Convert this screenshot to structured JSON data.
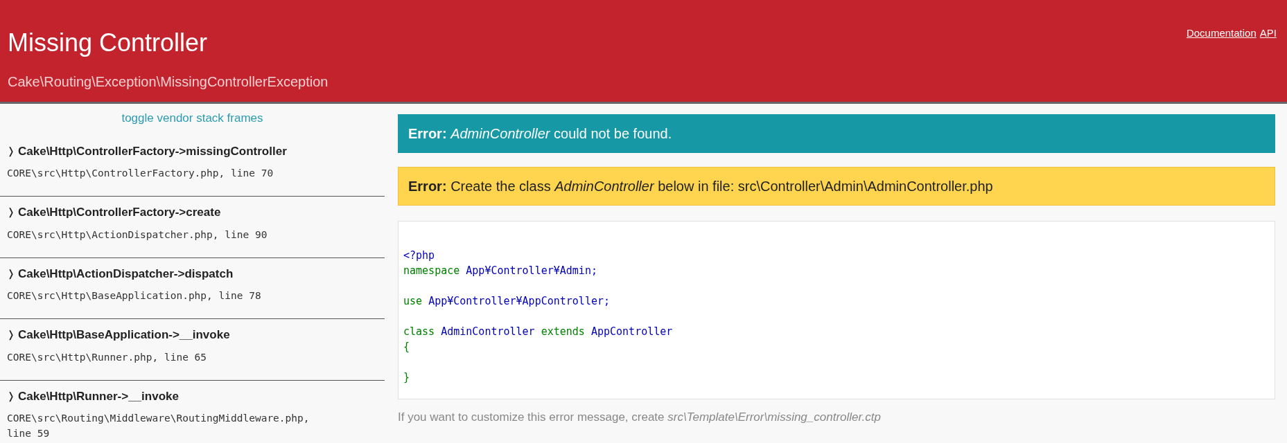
{
  "header": {
    "title": "Missing Controller",
    "subtitle": "Cake\\Routing\\Exception\\MissingControllerException",
    "links": [
      "Documentation",
      "API"
    ]
  },
  "sidebar": {
    "toggle": "toggle vendor stack frames",
    "frames": [
      {
        "marker": "❭",
        "call": "Cake\\Http\\ControllerFactory->missingController",
        "location": "CORE\\src\\Http\\ControllerFactory.php, line 70"
      },
      {
        "marker": "❭",
        "call": "Cake\\Http\\ControllerFactory->create",
        "location": "CORE\\src\\Http\\ActionDispatcher.php, line 90"
      },
      {
        "marker": "❭",
        "call": "Cake\\Http\\ActionDispatcher->dispatch",
        "location": "CORE\\src\\Http\\BaseApplication.php, line 78"
      },
      {
        "marker": "❭",
        "call": "Cake\\Http\\BaseApplication->__invoke",
        "location": "CORE\\src\\Http\\Runner.php, line 65"
      },
      {
        "marker": "❭",
        "call": "Cake\\Http\\Runner->__invoke",
        "location": "CORE\\src\\Routing\\Middleware\\RoutingMiddleware.php, line 59"
      }
    ]
  },
  "messages": [
    {
      "kind": "error",
      "text": "**Error:** *AdminController* could not be found."
    },
    {
      "kind": "warning",
      "text": "**Error:** Create the class *AdminController* below in file: src\\Controller\\Admin\\AdminController.php"
    }
  ],
  "code": [
    {
      "kind": "blank"
    },
    {
      "kind": "line",
      "tokens": [
        {
          "kind": "name",
          "text": "<?php"
        }
      ]
    },
    {
      "kind": "line",
      "tokens": [
        {
          "kind": "keyword",
          "text": "namespace "
        },
        {
          "kind": "name",
          "text": "App¥Controller¥Admin;"
        }
      ]
    },
    {
      "kind": "blank"
    },
    {
      "kind": "line",
      "tokens": [
        {
          "kind": "keyword",
          "text": "use "
        },
        {
          "kind": "name",
          "text": "App¥Controller¥AppController;"
        }
      ]
    },
    {
      "kind": "blank"
    },
    {
      "kind": "line",
      "tokens": [
        {
          "kind": "keyword",
          "text": "class "
        },
        {
          "kind": "name",
          "text": "AdminController "
        },
        {
          "kind": "keyword",
          "text": "extends "
        },
        {
          "kind": "name",
          "text": "AppController"
        }
      ]
    },
    {
      "kind": "line",
      "tokens": [
        {
          "kind": "keyword",
          "text": "{"
        }
      ]
    },
    {
      "kind": "blank"
    },
    {
      "kind": "line",
      "tokens": [
        {
          "kind": "keyword",
          "text": "}"
        }
      ]
    }
  ],
  "footer": "If you want to customize this error message, create *src\\Template\\Error\\missing_controller.ctp*"
}
